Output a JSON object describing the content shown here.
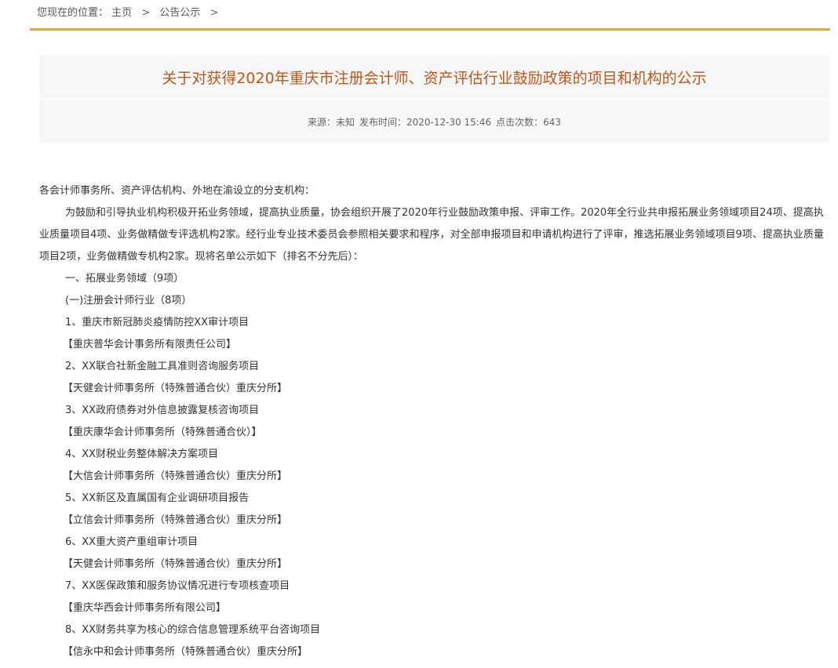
{
  "breadcrumb": {
    "label": "您现在的位置：",
    "home": "主页",
    "separator": ">",
    "section": "公告公示",
    "trailing": ">"
  },
  "article": {
    "title": "关于对获得2020年重庆市注册会计师、资产评估行业鼓励政策的项目和机构的公示",
    "meta": {
      "source": "来源：未知",
      "published": "发布时间：2020-12-30 15:46",
      "views": "点击次数：643"
    },
    "salutation": "各会计师事务所、资产评估机构、外地在渝设立的分支机构：",
    "intro": "为鼓励和引导执业机构积极开拓业务领域，提高执业质量，协会组织开展了2020年行业鼓励政策申报、评审工作。2020年全行业共申报拓展业务领域项目24项、提高执业质量项目4项、业务做精做专评选机构2家。经行业专业技术委员会参照相关要求和程序，对全部申报项目和申请机构进行了评审，推选拓展业务领域项目9项、提高执业质量项目2项，业务做精做专机构2家。现将名单公示如下（排名不分先后）：",
    "section1": "一、拓展业务领域（9项）",
    "subsection1": "(一)注册会计师行业（8项）",
    "items": [
      {
        "project": "1、重庆市新冠肺炎疫情防控XX审计项目",
        "org": "【重庆普华会计事务所有限责任公司】"
      },
      {
        "project": "2、XX联合社新金融工具准则咨询服务项目",
        "org": "【天健会计师事务所（特殊普通合伙）重庆分所】"
      },
      {
        "project": "3、XX政府债券对外信息披露复核咨询项目",
        "org": "【重庆康华会计师事务所（特殊普通合伙）】"
      },
      {
        "project": "4、XX财税业务整体解决方案项目",
        "org": "【大信会计师事务所（特殊普通合伙）重庆分所】"
      },
      {
        "project": "5、XX新区及直属国有企业调研项目报告",
        "org": "【立信会计师事务所（特殊普通合伙）重庆分所】"
      },
      {
        "project": "6、XX重大资产重组审计项目",
        "org": "【天健会计师事务所（特殊普通合伙）重庆分所】"
      },
      {
        "project": "7、XX医保政策和服务协议情况进行专项核查项目",
        "org": "【重庆华西会计师事务所有限公司】"
      },
      {
        "project": "8、XX财务共享为核心的综合信息管理系统平台咨询项目",
        "org": "【信永中和会计师事务所（特殊普通合伙）重庆分所】"
      }
    ]
  }
}
